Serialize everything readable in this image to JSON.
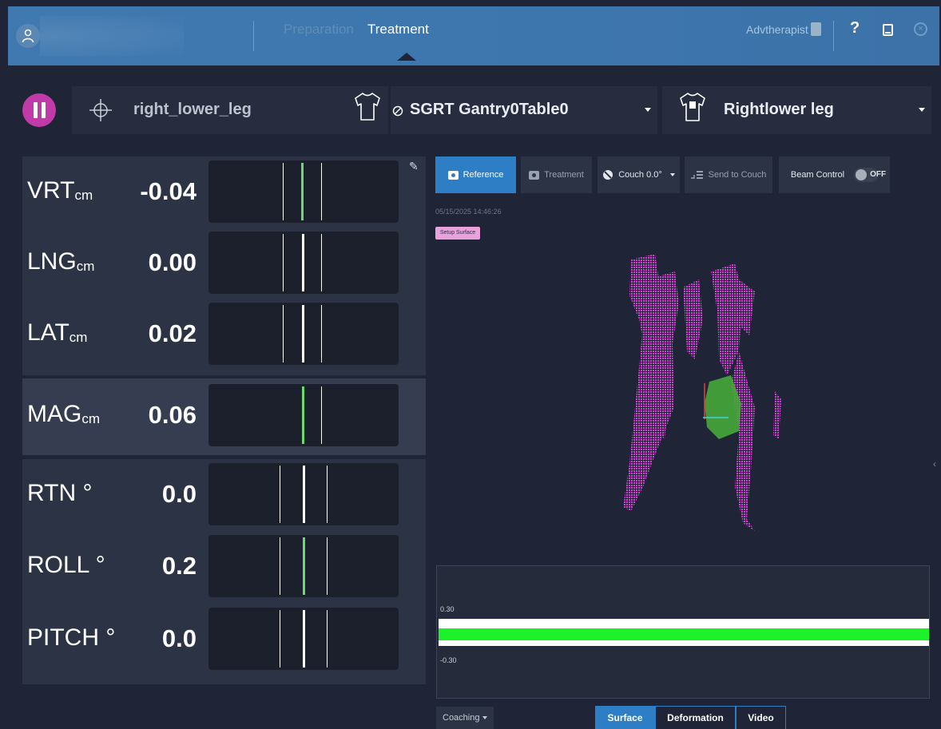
{
  "header": {
    "tabs": [
      {
        "label": "Preparation",
        "active": false
      },
      {
        "label": "Treatment",
        "active": true
      }
    ],
    "user": "Advtherapist",
    "help_label": "?"
  },
  "setup": {
    "target": "right_lower_leg",
    "gantry_table": "SGRT Gantry0Table0",
    "region": "Rightlower leg"
  },
  "metrics": [
    {
      "label": "VRT",
      "unit": "cm",
      "value": "-0.04"
    },
    {
      "label": "LNG",
      "unit": "cm",
      "value": "0.00"
    },
    {
      "label": "LAT",
      "unit": "cm",
      "value": "0.02"
    },
    {
      "label": "MAG",
      "unit": "cm",
      "value": "0.06"
    },
    {
      "label": "RTN",
      "unit": "°",
      "value": "0.0"
    },
    {
      "label": "ROLL",
      "unit": "°",
      "value": "0.2"
    },
    {
      "label": "PITCH",
      "unit": "°",
      "value": "0.0"
    }
  ],
  "toolbar": {
    "reference": "Reference",
    "treatment": "Treatment",
    "couch": "Couch 0.0°",
    "send_to_couch": "Send to Couch",
    "beam_control": "Beam Control",
    "beam_state": "OFF"
  },
  "capture": {
    "timestamp": "05/15/2025 14:46:26",
    "tag": "Setup Surface"
  },
  "graph": {
    "upper_label": "0.30",
    "lower_label": "-0.30"
  },
  "bottom": {
    "coaching": "Coaching",
    "views": [
      "Surface",
      "Deformation",
      "Video"
    ],
    "active_view": "Surface"
  },
  "colors": {
    "accent": "#2e7ec6",
    "pause": "#c03ba8",
    "surface": "#d040d0",
    "in_tolerance": "#1bf22a"
  }
}
